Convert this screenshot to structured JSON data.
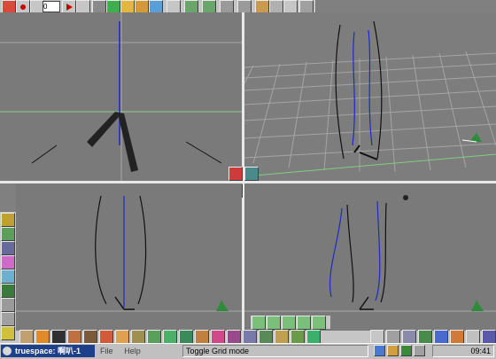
{
  "toolbar": {
    "frame_value": "0",
    "icons": [
      "new-icon",
      "record-icon",
      "rewind-icon",
      "play-icon",
      "forward-icon",
      "grid-icon",
      "object-icon",
      "paint-icon",
      "lock-icon",
      "camera-icon",
      "move-icon",
      "rotate-icon",
      "scale-icon",
      "deform-icon",
      "render-icon",
      "light-icon",
      "undo-icon",
      "material-icon",
      "up-icon",
      "delete-icon"
    ]
  },
  "taskbar": {
    "app_title": "truespace: 啊叭-1",
    "menu": [
      "File",
      "Help"
    ],
    "status": "Toggle Grid mode",
    "tray_time": "09:41"
  },
  "colors": {
    "viewport": "#7a7a7a",
    "grid": "#a8a8a8",
    "curve_black": "#111111",
    "curve_blue": "#1a2bc8",
    "taskbar_blue": "#1e3f8a"
  }
}
